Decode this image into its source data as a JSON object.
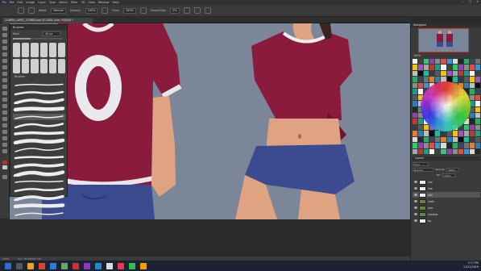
{
  "app": {
    "menu": [
      "Ps",
      "File",
      "Edit",
      "Image",
      "Layer",
      "Type",
      "Select",
      "Filter",
      "3D",
      "View",
      "Window",
      "Help"
    ],
    "window_controls": [
      "–",
      "▢",
      "✕"
    ]
  },
  "options_bar": {
    "mode_label": "Mode:",
    "mode_value": "Normal",
    "opacity_label": "Opacity:",
    "opacity_value": "100%",
    "flow_label": "Flow:",
    "flow_value": "100%",
    "smoothing_label": "Smoothing:",
    "smoothing_value": "0%"
  },
  "document": {
    "tab_title": "CHARM_LAP02_COMBO.psd @ 100% (line, RGB/8) *"
  },
  "brushes_panel": {
    "title": "Brushes",
    "size_label": "Size:",
    "size_value": "42 px",
    "size_fraction": 0.35,
    "folder_label": "Brushes",
    "stroke_count": 17,
    "selected_index": 4
  },
  "navigator": {
    "title": "Navigator",
    "zoom_value": "100%"
  },
  "swatches": {
    "title": "Swatches"
  },
  "layers": {
    "title": "Layers",
    "kind_label": "Kind",
    "blend_value": "Normal",
    "opacity_label": "Opacity:",
    "opacity_value": "100%",
    "fill_label": "Fill:",
    "fill_value": "100%",
    "items": [
      {
        "name": "line",
        "style": "normal"
      },
      {
        "name": "line",
        "style": "normal"
      },
      {
        "name": "skin",
        "style": "selected"
      },
      {
        "name": "cloth",
        "style": "green"
      },
      {
        "name": "hair",
        "style": "green"
      },
      {
        "name": "shadow",
        "style": "green"
      },
      {
        "name": "bg",
        "style": "normal"
      }
    ]
  },
  "status_bar": {
    "zoom": "100%",
    "doc": "Doc: 36.9M/327.1M"
  },
  "taskbar": {
    "time": "2:17 PM",
    "date": "11/21/2019"
  },
  "colors": {
    "canvas_bg": "#7a8597",
    "shirt": "#8a1b3c",
    "shorts": "#3c4b8f",
    "skin": "#e0a382"
  }
}
